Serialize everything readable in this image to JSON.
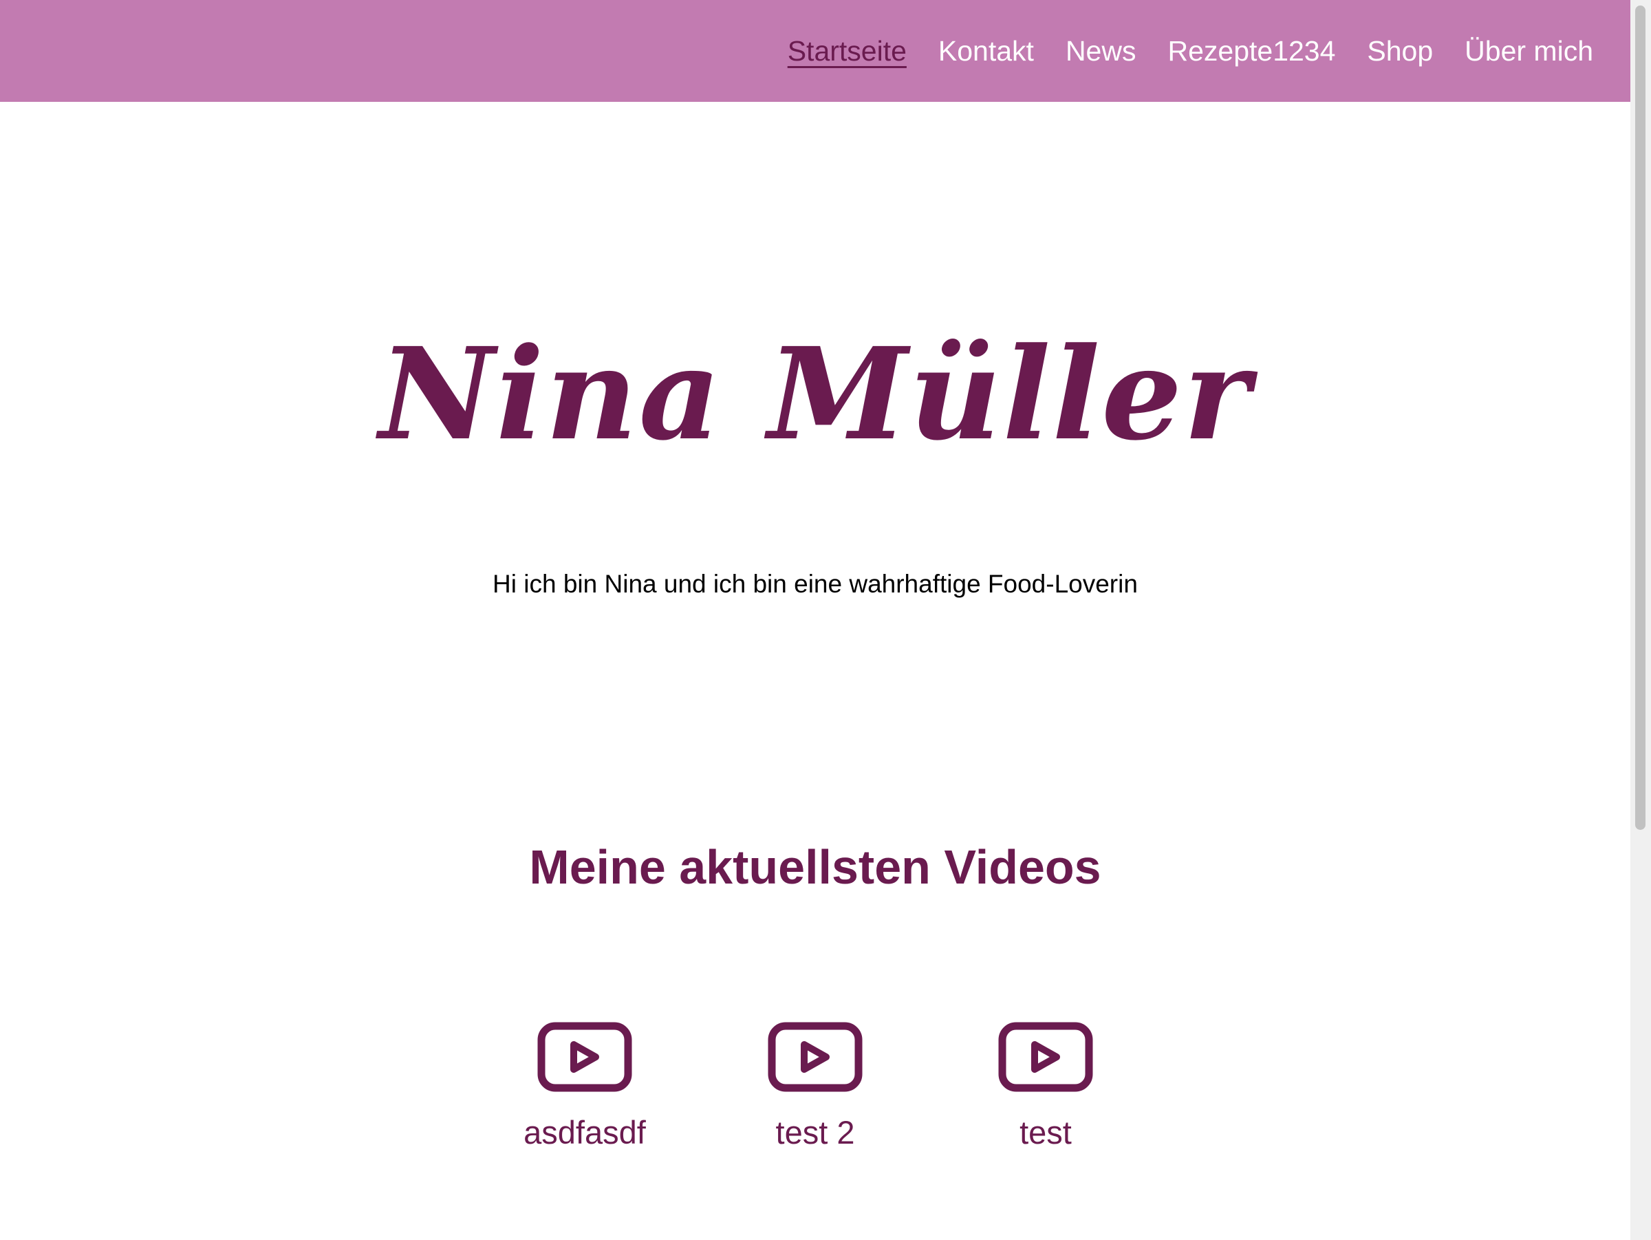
{
  "header": {
    "bg_color": "#c27bb1",
    "nav": [
      {
        "label": "Startseite",
        "active": true
      },
      {
        "label": "Kontakt",
        "active": false
      },
      {
        "label": "News",
        "active": false
      },
      {
        "label": "Rezepte1234",
        "active": false
      },
      {
        "label": "Shop",
        "active": false
      },
      {
        "label": "Über mich",
        "active": false
      }
    ]
  },
  "hero": {
    "title": "Nina Müller",
    "text": "Hi ich bin Nina und ich bin eine wahrhaftige Food-Loverin"
  },
  "videos_section": {
    "title": "Meine aktuellsten Videos",
    "videos": [
      {
        "title": "asdfasdf",
        "icon": "video-play-icon"
      },
      {
        "title": "test 2",
        "icon": "video-play-icon"
      },
      {
        "title": "test",
        "icon": "video-play-icon"
      }
    ]
  },
  "colors": {
    "accent": "#6a1b4f",
    "header": "#c27bb1",
    "text": "#000000"
  }
}
